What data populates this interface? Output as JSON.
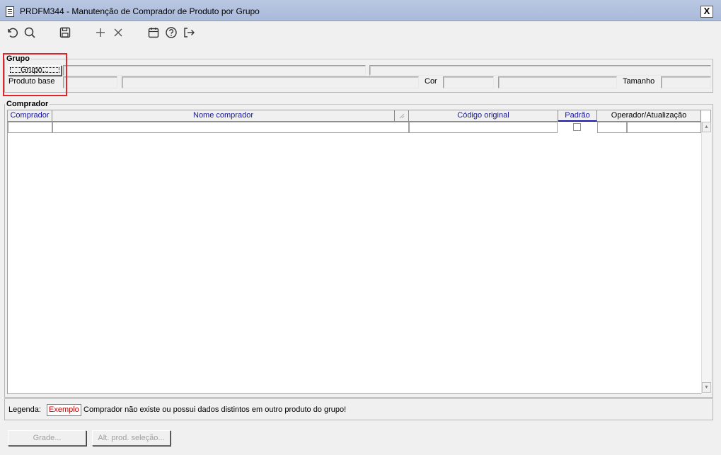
{
  "window": {
    "title": "PRDFM344 - Manutenção de Comprador de Produto por Grupo",
    "close_label": "X"
  },
  "toolbar": {
    "icons": [
      "undo-icon",
      "search-icon",
      "save-icon",
      "add-icon",
      "delete-icon",
      "calendar-icon",
      "help-icon",
      "exit-icon"
    ]
  },
  "grupo": {
    "legend": "Grupo",
    "grupo_button": "Grupo...",
    "produto_base_label": "Produto base",
    "cor_label": "Cor",
    "tamanho_label": "Tamanho"
  },
  "comprador": {
    "legend": "Comprador",
    "columns": {
      "comprador": "Comprador",
      "nome": "Nome comprador",
      "codigo": "Código original",
      "padrao": "Padrão",
      "operador": "Operador/Atualização"
    }
  },
  "legenda": {
    "label": "Legenda:",
    "example": "Exemplo",
    "description": "Comprador não existe ou possui dados distintos em outro produto do grupo!"
  },
  "footer": {
    "grade_button": "Grade...",
    "alt_button": "Alt. prod. seleção..."
  },
  "colors": {
    "title_bar": "#a9bad9",
    "header_blue": "#1515a0",
    "legend_red": "#c00000",
    "highlight": "#e0242a"
  }
}
